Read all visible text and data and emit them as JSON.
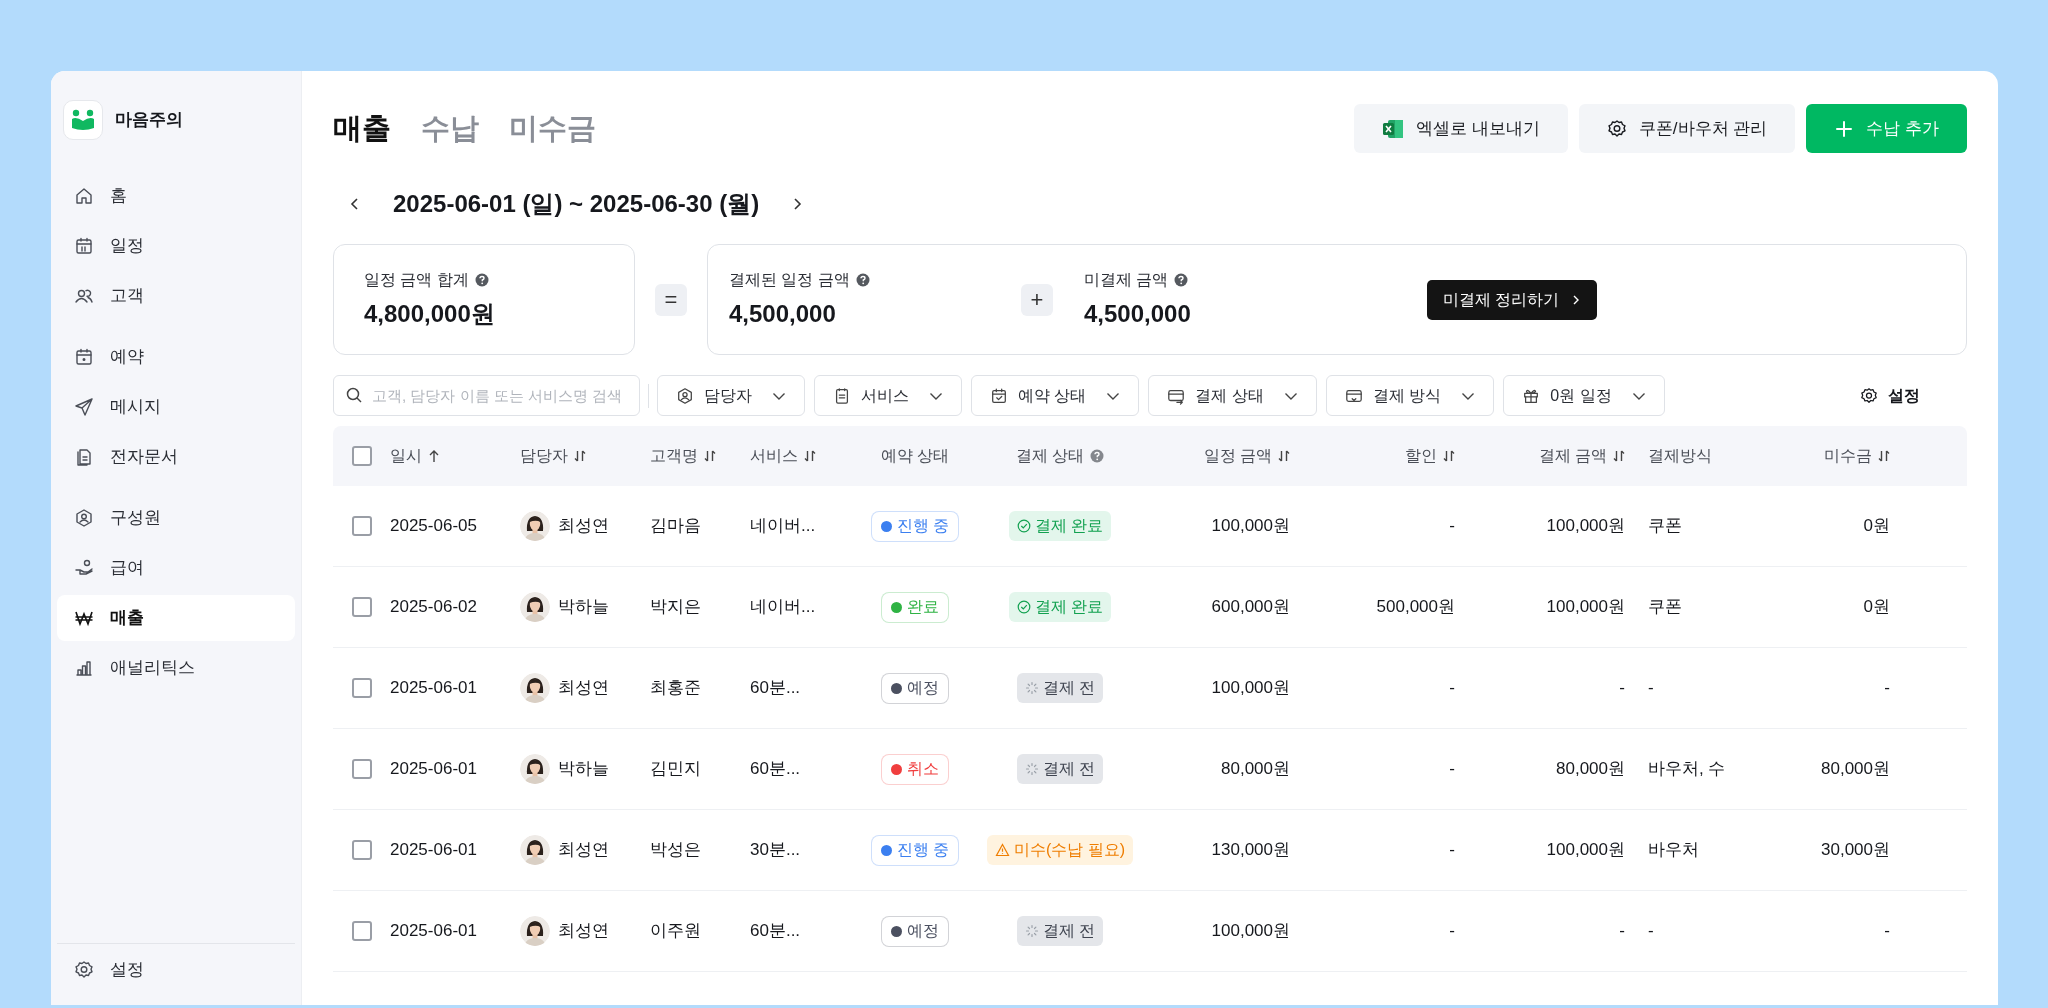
{
  "app": {
    "name": "마음주의"
  },
  "sidebar": {
    "groups": [
      [
        {
          "label": "홈",
          "selected": false
        },
        {
          "label": "일정",
          "selected": false
        },
        {
          "label": "고객",
          "selected": false
        }
      ],
      [
        {
          "label": "예약",
          "selected": false
        },
        {
          "label": "메시지",
          "selected": false
        },
        {
          "label": "전자문서",
          "selected": false
        }
      ],
      [
        {
          "label": "구성원",
          "selected": false
        },
        {
          "label": "급여",
          "selected": false
        },
        {
          "label": "매출",
          "selected": true
        },
        {
          "label": "애널리틱스",
          "selected": false
        }
      ]
    ],
    "footer": {
      "label": "설정"
    }
  },
  "tabs": [
    {
      "label": "매출",
      "selected": true
    },
    {
      "label": "수납",
      "selected": false
    },
    {
      "label": "미수금",
      "selected": false
    }
  ],
  "actions": [
    {
      "label": "엑셀로 내보내기",
      "kind": "secondary"
    },
    {
      "label": "쿠폰/바우처 관리",
      "kind": "secondary"
    },
    {
      "label": "수납 추가",
      "kind": "primary"
    }
  ],
  "date_range": {
    "label": "2025-06-01 (일) ~ 2025-06-30 (월)"
  },
  "summary": {
    "total": {
      "label": "일정 금액 합계",
      "value": "4,800,000원"
    },
    "operator_1": "=",
    "paid": {
      "label": "결제된 일정 금액",
      "value": "4,500,000"
    },
    "operator_2": "+",
    "unpaid": {
      "label": "미결제 금액",
      "value": "4,500,000"
    },
    "settle_button": "미결제 정리하기"
  },
  "search": {
    "placeholder": "고객, 담당자 이름 또는 서비스명 검색"
  },
  "filters": [
    {
      "label": "담당자"
    },
    {
      "label": "서비스"
    },
    {
      "label": "예약 상태"
    },
    {
      "label": "결제 상태"
    },
    {
      "label": "결제 방식"
    },
    {
      "label": "0원 일정"
    }
  ],
  "settings_button": "설정",
  "table": {
    "select_all": {
      "checked": false
    },
    "columns": [
      {
        "label": "일시",
        "sortable": true,
        "sorted_ascending": true
      },
      {
        "label": "담당자",
        "sortable": true
      },
      {
        "label": "고객명",
        "sortable": true
      },
      {
        "label": "서비스",
        "sortable": true
      },
      {
        "label": "예약 상태"
      },
      {
        "label": "결제 상태",
        "help": true
      },
      {
        "label": "일정 금액",
        "sortable": true
      },
      {
        "label": "할인",
        "sortable": true
      },
      {
        "label": "결제 금액",
        "sortable": true
      },
      {
        "label": "결제방식"
      },
      {
        "label": "미수금",
        "sortable": true
      }
    ],
    "rows": [
      {
        "checked": false,
        "date": "2025-06-05",
        "staff": "최성연",
        "customer": "김마음",
        "service": "네이버...",
        "booking": {
          "label": "진행 중",
          "color": "#3b7ff0"
        },
        "payment": {
          "label": "결제 완료",
          "kind": "paid"
        },
        "amount": "100,000원",
        "discount": "-",
        "paid": "100,000원",
        "method": "쿠폰",
        "outstanding": "0원"
      },
      {
        "checked": false,
        "date": "2025-06-02",
        "staff": "박하늘",
        "customer": "박지은",
        "service": "네이버...",
        "booking": {
          "label": "완료",
          "color": "#2fb344"
        },
        "payment": {
          "label": "결제 완료",
          "kind": "paid"
        },
        "amount": "600,000원",
        "discount": "500,000원",
        "paid": "100,000원",
        "method": "쿠폰",
        "outstanding": "0원"
      },
      {
        "checked": false,
        "date": "2025-06-01",
        "staff": "최성연",
        "customer": "최홍준",
        "service": "60분...",
        "booking": {
          "label": "예정",
          "color": "#4b5060"
        },
        "payment": {
          "label": "결제 전",
          "kind": "pending"
        },
        "amount": "100,000원",
        "discount": "-",
        "paid": "-",
        "method": "-",
        "outstanding": "-"
      },
      {
        "checked": false,
        "date": "2025-06-01",
        "staff": "박하늘",
        "customer": "김민지",
        "service": "60분...",
        "booking": {
          "label": "취소",
          "color": "#f03e3e"
        },
        "payment": {
          "label": "결제 전",
          "kind": "pending"
        },
        "amount": "80,000원",
        "discount": "-",
        "paid": "80,000원",
        "method": "바우처, 수",
        "outstanding": "80,000원"
      },
      {
        "checked": false,
        "date": "2025-06-01",
        "staff": "최성연",
        "customer": "박성은",
        "service": "30분...",
        "booking": {
          "label": "진행 중",
          "color": "#3b7ff0"
        },
        "payment": {
          "label": "미수(수납 필요)",
          "kind": "unpaid"
        },
        "amount": "130,000원",
        "discount": "-",
        "paid": "100,000원",
        "method": "바우처",
        "outstanding": "30,000원"
      },
      {
        "checked": false,
        "date": "2025-06-01",
        "staff": "최성연",
        "customer": "이주원",
        "service": "60분...",
        "booking": {
          "label": "예정",
          "color": "#4b5060"
        },
        "payment": {
          "label": "결제 전",
          "kind": "pending"
        },
        "amount": "100,000원",
        "discount": "-",
        "paid": "-",
        "method": "-",
        "outstanding": "-"
      }
    ]
  }
}
